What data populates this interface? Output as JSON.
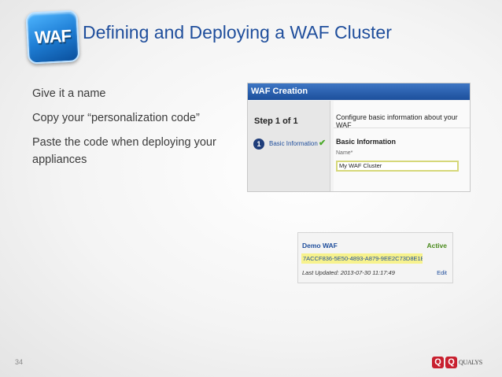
{
  "slide": {
    "logo_text": "WAF",
    "title": "Defining and Deploying a WAF Cluster",
    "bullets": [
      "Give it a name",
      "Copy your “personalization code”",
      "Paste the code when deploying your appliances"
    ],
    "page_number": "34"
  },
  "dialog": {
    "header": "WAF Creation",
    "step_label": "Step 1 of 1",
    "step_number": "1",
    "step_item": "Basic Information",
    "description": "Configure basic information about your WAF",
    "section": "Basic Information",
    "field_label": "Name*",
    "field_value": "My WAF Cluster"
  },
  "waf_panel": {
    "name": "Demo WAF",
    "status": "Active",
    "code": "7ACCF836-5E50-4893-A879-9EE2C73D8E1B",
    "last_updated": "Last Updated: 2013-07-30 11:17:49",
    "edit_label": "Edit"
  },
  "brand": {
    "icon_letters": [
      "Q",
      "Q"
    ],
    "name": "QUALYS"
  },
  "colors": {
    "title": "#1f4e9c",
    "header_blue": "#1c4f9c",
    "highlight": "#f7f28d",
    "status_green": "#4a8a1c",
    "brand_red": "#c8202f"
  }
}
